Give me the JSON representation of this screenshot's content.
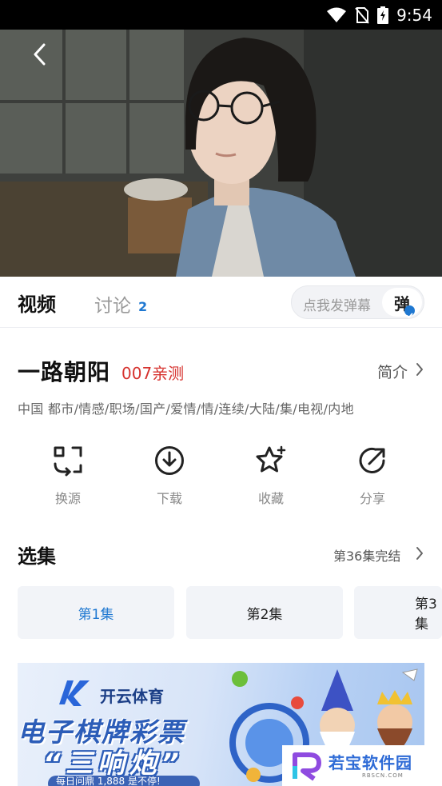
{
  "status_bar": {
    "time": "9:54",
    "icons": [
      "wifi-icon",
      "no-sim-icon",
      "battery-charging-icon"
    ]
  },
  "player": {
    "back_icon": "chevron-left-icon"
  },
  "tabs": [
    {
      "label": "视频",
      "active": true
    },
    {
      "label": "讨论",
      "count": "2",
      "active": false
    }
  ],
  "danmaku": {
    "placeholder": "点我发弹幕",
    "toggle_label": "弹"
  },
  "show": {
    "title": "一路朝阳",
    "tag": "007亲测",
    "intro_label": "简介",
    "genres": "中国  都市/情感/职场/国产/爱情/情/连续/大陆/集/电视/内地"
  },
  "actions": [
    {
      "label": "换源",
      "icon": "switch-source-icon"
    },
    {
      "label": "下载",
      "icon": "download-icon"
    },
    {
      "label": "收藏",
      "icon": "star-icon"
    },
    {
      "label": "分享",
      "icon": "share-icon"
    }
  ],
  "episodes": {
    "title": "选集",
    "status": "第36集完结",
    "items": [
      "第1集",
      "第2集",
      "第3集"
    ],
    "selected": "第1集"
  },
  "banner": {
    "brand": "开云体育",
    "headline": "电子棋牌彩票",
    "sub": "“三响炮”",
    "footer": "每日问鼎 1,888 是不停!"
  },
  "watermark": {
    "text": "若宝软件园",
    "sub": "RBSCN.COM"
  },
  "colors": {
    "accent": "#1f78d1",
    "tag_red": "#d6322e",
    "episode_bg": "#f2f4f8"
  }
}
